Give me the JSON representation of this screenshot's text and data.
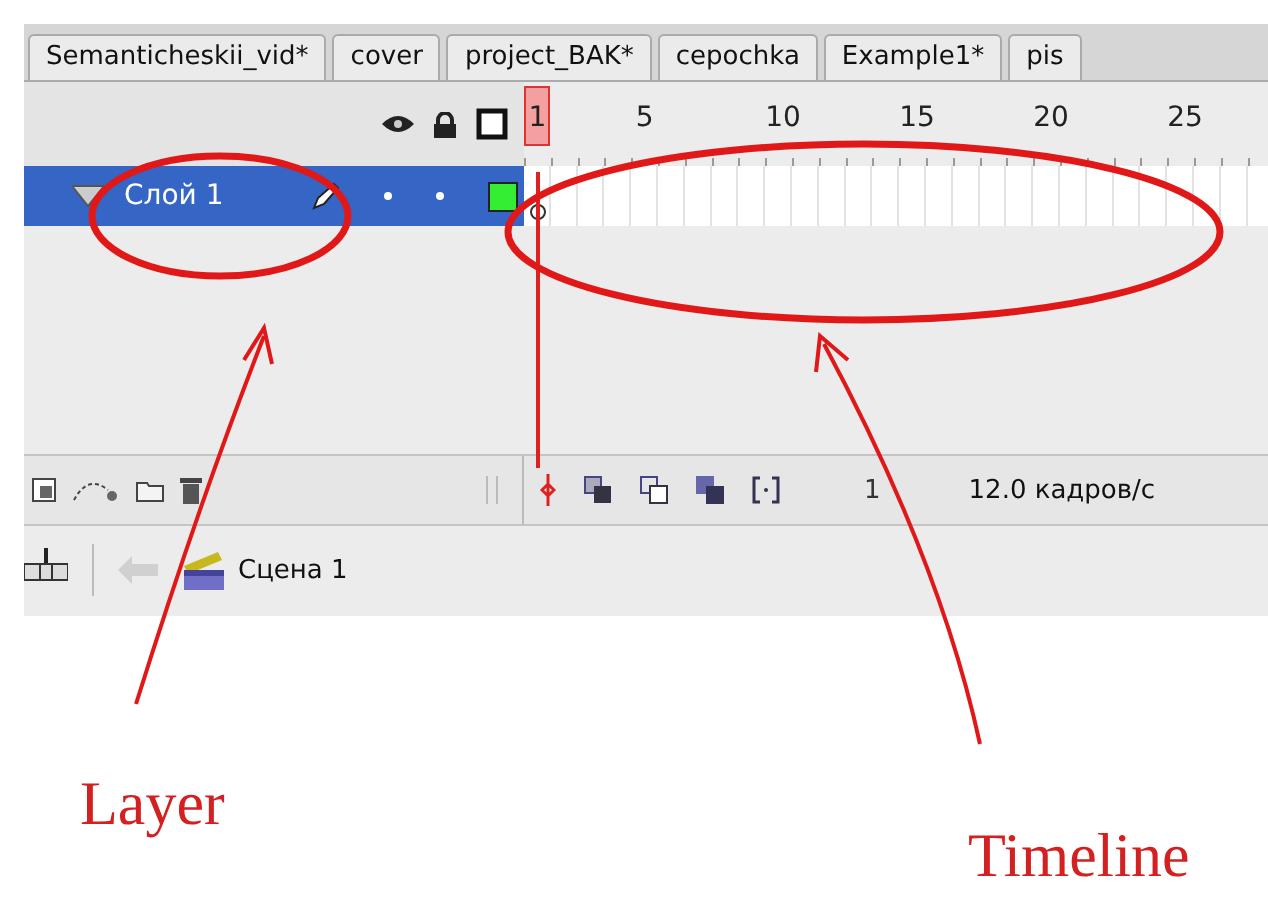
{
  "tabs": [
    {
      "label": "Semanticheskii_vid*"
    },
    {
      "label": "cover"
    },
    {
      "label": "project_BAK*"
    },
    {
      "label": "cepochka"
    },
    {
      "label": "Example1*"
    },
    {
      "label": "pis"
    }
  ],
  "ruler": [
    "1",
    "5",
    "10",
    "15",
    "20",
    "25"
  ],
  "layers": [
    {
      "name": "Слой 1",
      "selected": true,
      "color": "#33ee33"
    }
  ],
  "toolbar": {
    "current_frame": "1",
    "frame_rate": "12.0 кадров/с"
  },
  "scene": {
    "label": "Сцена 1"
  },
  "annotations": [
    {
      "label": "Layer"
    },
    {
      "label": "Timeline"
    }
  ]
}
